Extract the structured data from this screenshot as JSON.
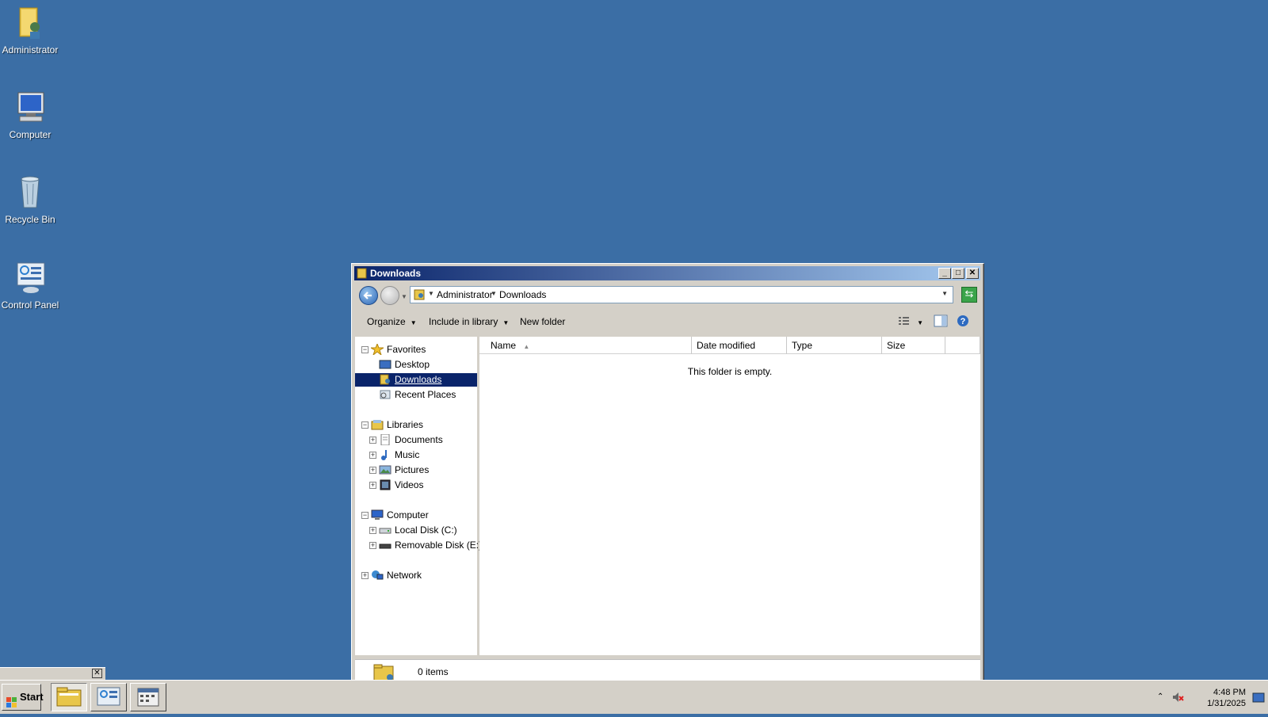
{
  "desktop": {
    "icons": [
      {
        "label": "Administrator",
        "icon": "user-folder-icon"
      },
      {
        "label": "Computer",
        "icon": "computer-icon"
      },
      {
        "label": "Recycle Bin",
        "icon": "recycle-bin-icon"
      },
      {
        "label": "Control Panel",
        "icon": "control-panel-icon"
      }
    ]
  },
  "window": {
    "title": "Downloads",
    "address": {
      "crumbs": [
        "Administrator",
        "Downloads"
      ]
    },
    "commands": {
      "organize": "Organize",
      "include_in_library": "Include in library",
      "new_folder": "New folder"
    },
    "nav": {
      "favorites": {
        "label": "Favorites",
        "items": [
          "Desktop",
          "Downloads",
          "Recent Places"
        ],
        "selected": "Downloads"
      },
      "libraries": {
        "label": "Libraries",
        "items": [
          "Documents",
          "Music",
          "Pictures",
          "Videos"
        ]
      },
      "computer": {
        "label": "Computer",
        "items": [
          "Local Disk (C:)",
          "Removable Disk (E:)"
        ]
      },
      "network": {
        "label": "Network"
      }
    },
    "columns": [
      "Name",
      "Date modified",
      "Type",
      "Size"
    ],
    "empty_message": "This folder is empty.",
    "status": {
      "item_count": "0 items"
    }
  },
  "taskbar": {
    "start_label": "Start",
    "clock": {
      "time": "4:48 PM",
      "date": "1/31/2025"
    }
  },
  "colors": {
    "desktop": "#3b6ea5",
    "titlebar_start": "#0a246a",
    "titlebar_end": "#a6caf0",
    "selection": "#0a246a"
  }
}
